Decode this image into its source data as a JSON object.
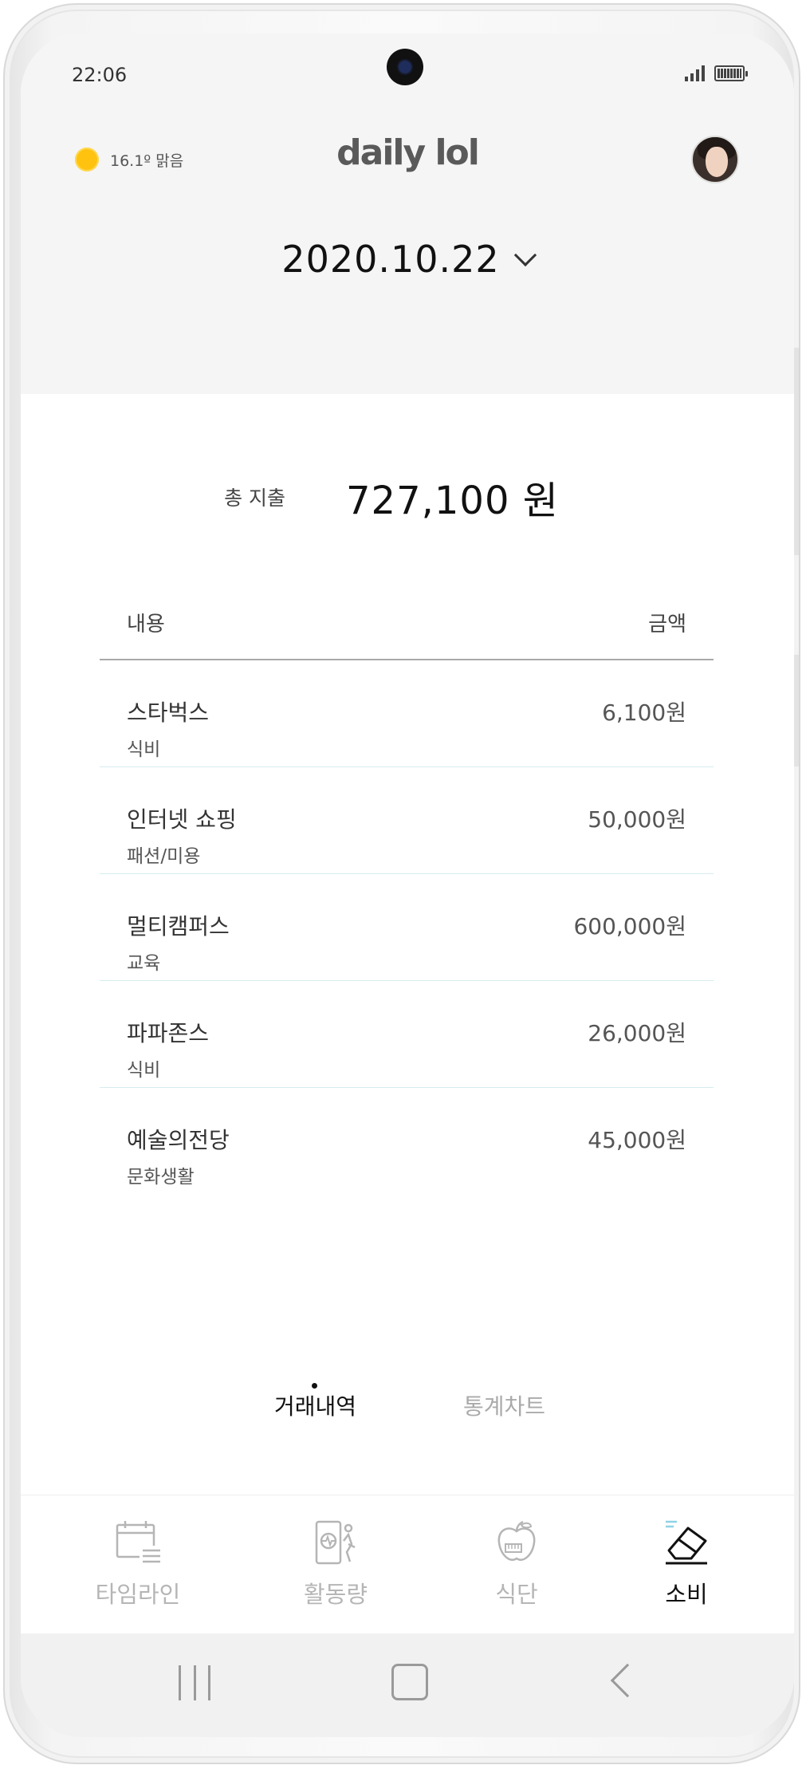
{
  "status_bar": {
    "time": "22:06"
  },
  "header": {
    "weather": "16.1º 맑음",
    "logo": "daily lol",
    "date": "2020.10.22"
  },
  "summary": {
    "label": "총 지출",
    "value": "727,100 원"
  },
  "table": {
    "col_content": "내용",
    "col_amount": "금액",
    "rows": [
      {
        "name": "스타벅스",
        "category": "식비",
        "amount": "6,100원"
      },
      {
        "name": "인터넷 쇼핑",
        "category": "패션/미용",
        "amount": "50,000원"
      },
      {
        "name": "멀티캠퍼스",
        "category": "교육",
        "amount": "600,000원"
      },
      {
        "name": "파파존스",
        "category": "식비",
        "amount": "26,000원"
      },
      {
        "name": "예술의전당",
        "category": "문화생활",
        "amount": "45,000원"
      }
    ]
  },
  "sub_tabs": [
    {
      "label": "거래내역",
      "active": true
    },
    {
      "label": "통계차트",
      "active": false
    }
  ],
  "bottom_nav": [
    {
      "label": "타임라인",
      "icon": "calendar-list-icon",
      "active": false
    },
    {
      "label": "활동량",
      "icon": "activity-phone-icon",
      "active": false
    },
    {
      "label": "식단",
      "icon": "apple-icon",
      "active": false
    },
    {
      "label": "소비",
      "icon": "eraser-card-icon",
      "active": true
    }
  ],
  "colors": {
    "accent_sun": "#ffc20e",
    "header_bg": "#f5f5f5",
    "row_divider": "#d6ecef",
    "nav_inactive": "#b5b5b5"
  }
}
